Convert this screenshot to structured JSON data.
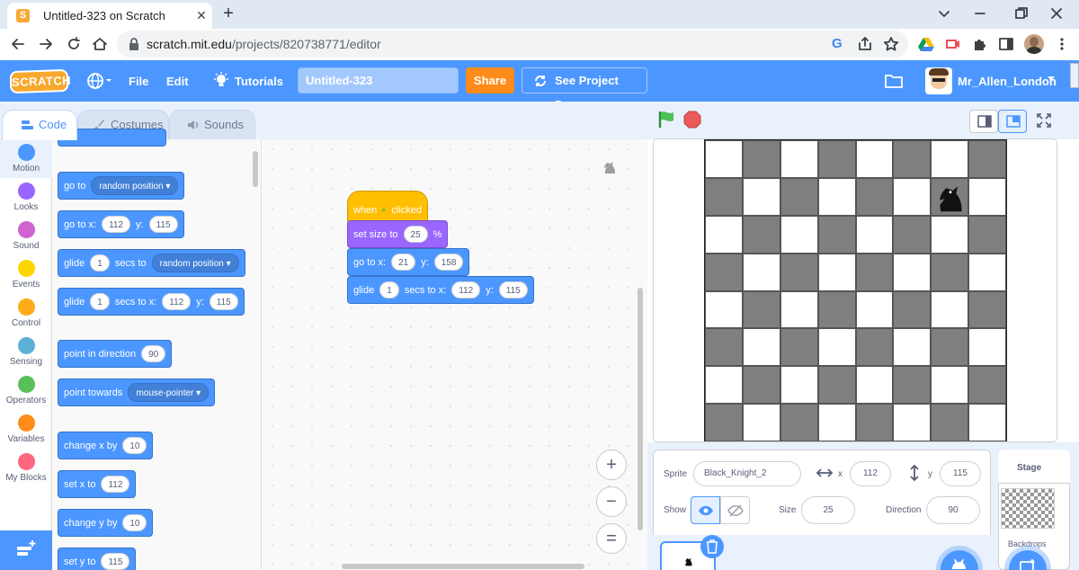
{
  "browser": {
    "tab_title": "Untitled-323 on Scratch",
    "favicon_letter": "S",
    "url_host": "scratch.mit.edu",
    "url_path": "/projects/820738771/editor"
  },
  "menu": {
    "logo": "SCRATCH",
    "file": "File",
    "edit": "Edit",
    "tutorials": "Tutorials",
    "project_title": "Untitled-323",
    "share": "Share",
    "see_project": "See Project Page",
    "username": "Mr_Allen_London"
  },
  "tabs": {
    "code": "Code",
    "costumes": "Costumes",
    "sounds": "Sounds"
  },
  "categories": [
    {
      "label": "Motion",
      "color": "#4c97ff"
    },
    {
      "label": "Looks",
      "color": "#9966ff"
    },
    {
      "label": "Sound",
      "color": "#cf63cf"
    },
    {
      "label": "Events",
      "color": "#ffd500"
    },
    {
      "label": "Control",
      "color": "#ffab19"
    },
    {
      "label": "Sensing",
      "color": "#5cb1d6"
    },
    {
      "label": "Operators",
      "color": "#59c059"
    },
    {
      "label": "Variables",
      "color": "#ff8c1a"
    },
    {
      "label": "My Blocks",
      "color": "#ff6680"
    }
  ],
  "palette": {
    "goto_random": {
      "text": "go to",
      "option": "random position"
    },
    "goto_xy": {
      "text": "go to x:",
      "x": "112",
      "ylabel": "y:",
      "y": "115"
    },
    "glide_random": {
      "text": "glide",
      "secs": "1",
      "mid": "secs to",
      "option": "random position"
    },
    "glide_xy": {
      "text": "glide",
      "secs": "1",
      "mid": "secs to x:",
      "x": "112",
      "ylabel": "y:",
      "y": "115"
    },
    "point_dir": {
      "text": "point in direction",
      "value": "90"
    },
    "point_towards": {
      "text": "point towards",
      "option": "mouse-pointer"
    },
    "change_x": {
      "text": "change x by",
      "value": "10"
    },
    "set_x": {
      "text": "set x to",
      "value": "112"
    },
    "change_y": {
      "text": "change y by",
      "value": "10"
    },
    "set_y": {
      "text": "set y to",
      "value": "115"
    }
  },
  "script": {
    "hat": {
      "when": "when",
      "clicked": "clicked"
    },
    "set_size": {
      "text": "set size to",
      "value": "25",
      "unit": "%"
    },
    "goto": {
      "text": "go to x:",
      "x": "21",
      "ylabel": "y:",
      "y": "158"
    },
    "glide": {
      "text": "glide",
      "secs": "1",
      "mid": "secs to x:",
      "x": "112",
      "ylabel": "y:",
      "y": "115"
    }
  },
  "zoom": {
    "in": "+",
    "out": "−",
    "reset": "="
  },
  "sprite_info": {
    "sprite_label": "Sprite",
    "sprite_name": "Black_Knight_2",
    "x_label": "x",
    "x": "112",
    "y_label": "y",
    "y": "115",
    "show_label": "Show",
    "size_label": "Size",
    "size": "25",
    "direction_label": "Direction",
    "direction": "90"
  },
  "stage_panel": {
    "title": "Stage",
    "backdrops": "Backdrops"
  },
  "knight_square": {
    "row": 1,
    "col": 6
  }
}
